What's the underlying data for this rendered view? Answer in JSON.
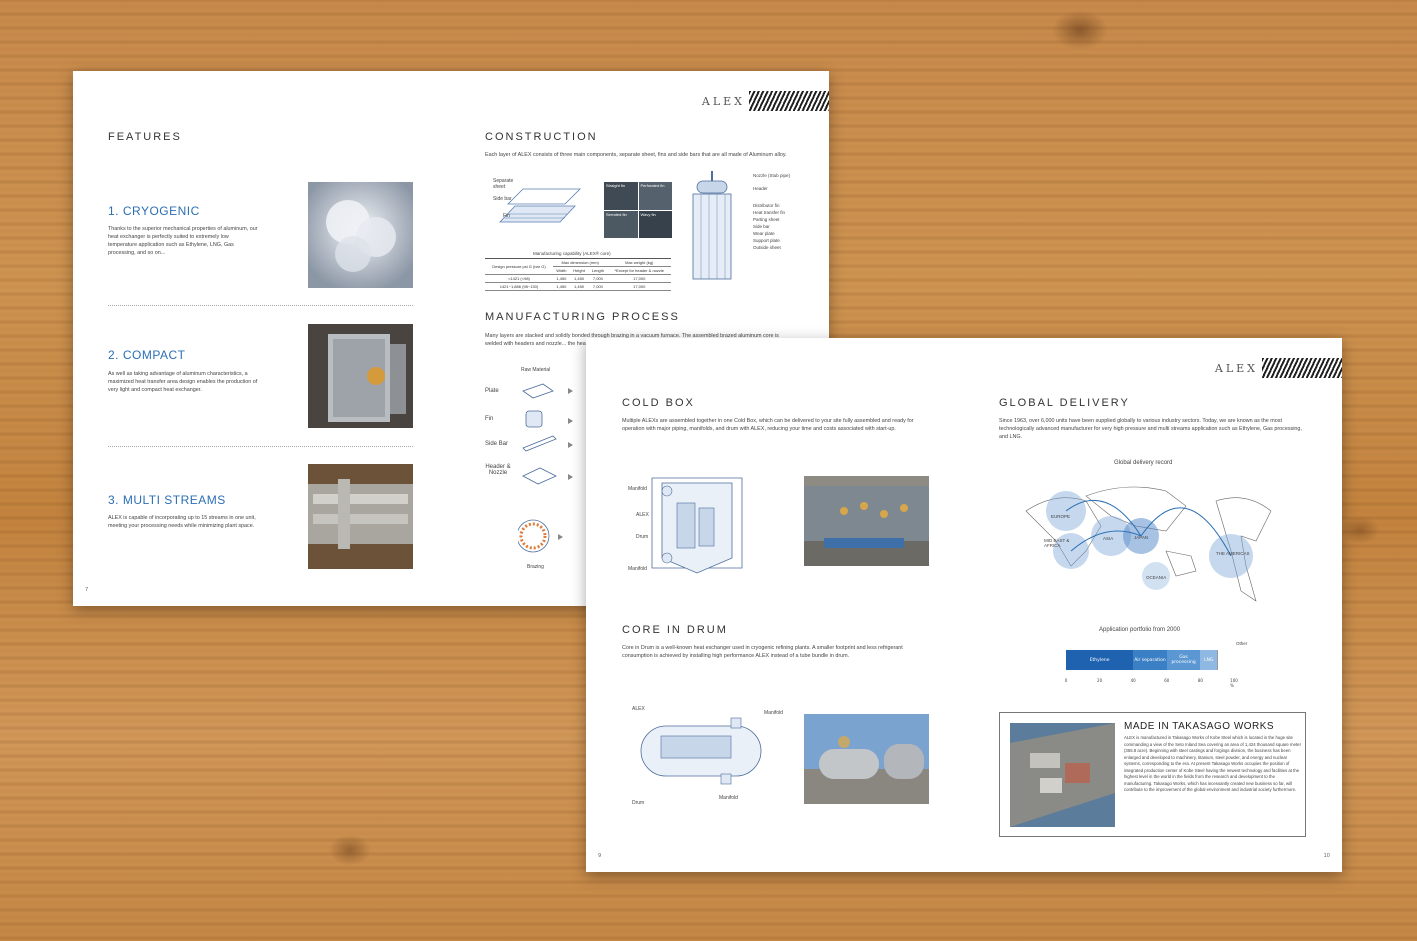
{
  "left_sheet": {
    "logo": "ALEX",
    "features_title": "Features",
    "features": [
      {
        "title": "1. CRYOGENIC",
        "text": "Thanks to the superior mechanical properties of aluminum, our heat exchanger is perfectly suited to extremely low temperature application such as Ethylene, LNG, Gas processing, and so on..."
      },
      {
        "title": "2. COMPACT",
        "text": "As well as taking advantage of aluminum characteristics, a maximized heat transfer area design enables the production of very light and compact heat exchanger."
      },
      {
        "title": "3. MULTI STREAMS",
        "text": "ALEX is capable of incorporating up to 15 streams in one unit, meeting your processing needs while minimizing plant space."
      }
    ],
    "construction_title": "Construction",
    "construction_text": "Each layer of ALEX consists of three main components, separate sheet, fins and side bars that are all made of Aluminum alloy.",
    "construction_labels": [
      "Separate sheet",
      "Side bar",
      "Fin"
    ],
    "fin_types": [
      "Straight fin",
      "Perforated fin",
      "Serrated fin",
      "Wavy fin"
    ],
    "assembly_labels": [
      "Nozzle (Stub pipe)",
      "Header",
      "Distributor fin",
      "Heat transfer fin",
      "Parting sheet",
      "Side bar",
      "Wear plate",
      "Support plate",
      "Outside sheet"
    ],
    "table": {
      "caption": "Manufacturing capability (ALEX® core)",
      "headers": [
        "Design pressure psi G (bar G)",
        "Max dimension (mm)",
        "Max weight (kg)"
      ],
      "subheaders": [
        "Width",
        "Height",
        "Length",
        "*Except for header & nozzle"
      ],
      "rows": [
        [
          "<1421 (<98)",
          "1,450",
          "1,450",
          "7,000",
          "17,000"
        ],
        [
          "1421~1,886 (98~130)",
          "1,450",
          "1,450",
          "7,000",
          "17,000"
        ]
      ]
    },
    "mfg_title": "Manufacturing process",
    "mfg_text": "Many layers are stacked and solidly bonded through brazing in a vacuum furnace. The assembled brazed aluminum core is welded with headers and nozzle... the heat transfer area but also the a...",
    "raw_material": "Raw Material",
    "process_items": [
      "Plate",
      "Fin",
      "Side Bar",
      "Header & Nozzle"
    ],
    "brazing": "Brazing",
    "page": "7"
  },
  "right_sheet": {
    "logo": "ALEX",
    "coldbox_title": "Cold box",
    "coldbox_text": "Multiple ALEXs are assembled together in one Cold Box, which can be delivered to your site fully assembled and ready for operation with major piping, manifolds, and drum with ALEX, reducing your time and costs associated with start-up.",
    "coldbox_labels": [
      "Manifold",
      "ALEX",
      "Drum",
      "Manifold"
    ],
    "cid_title": "Core in drum",
    "cid_text": "Core in Drum is a well-known heat exchanger used in cryogenic refining plants. A smaller footprint and less refrigerant consumption is achieved by installing high performance ALEX instead of a tube bundle in drum.",
    "cid_labels": [
      "ALEX",
      "Manifold",
      "Drum",
      "Manifold"
    ],
    "global_title": "Global delivery",
    "global_text": "Since 1963, over 6,000 units have been supplied globally to various industry sectors. Today, we are known as the most technologically advanced manufacturer for very high pressure and multi streams application such as Ethylene, Gas processing, and LNG.",
    "map_title": "Global delivery record",
    "regions": [
      "EUROPE",
      "MID EAST & AFRICA",
      "ASIA",
      "JAPAN",
      "THE AMERICAS",
      "OCEANIA"
    ],
    "portfolio_title": "Application portfolio from 2000",
    "portfolio": [
      {
        "label": "Ethylene",
        "share": 0.4,
        "color": "#1f63b0"
      },
      {
        "label": "Air separation",
        "share": 0.2,
        "color": "#3b7fc4"
      },
      {
        "label": "Gas processing",
        "share": 0.2,
        "color": "#5b97d2"
      },
      {
        "label": "LNG",
        "share": 0.1,
        "color": "#8fb8e2"
      },
      {
        "label": "Other",
        "share": 0.1,
        "color": "#ffffff"
      }
    ],
    "axis": [
      "0",
      "20",
      "40",
      "60",
      "80",
      "100 %"
    ],
    "takasago_title": "MADE IN TAKASAGO WORKS",
    "takasago_text": "ALEX is manufactured in Takasago Works of Kobe Steel which is located in the huge site commanding a view of the Seto Inland Sea covering an area of 1,424 thousand square meter (355.8 acre). Beginning with steel castings and forgings division, the business has been enlarged and developed to machinery, titanium, steel powder, and energy and nuclear systems, corresponding to the era. At present Takasago Works occupies the position of integrated production center of Kobe Steel having the newest technology and facilities at the highest level in the world in the fields from the research and development to the manufacturing. Takasago Works, which has incessantly created new business so far, will contribute to the improvement of the global environment and industrial society furthermore.",
    "page_left": "9",
    "page_right": "10"
  }
}
